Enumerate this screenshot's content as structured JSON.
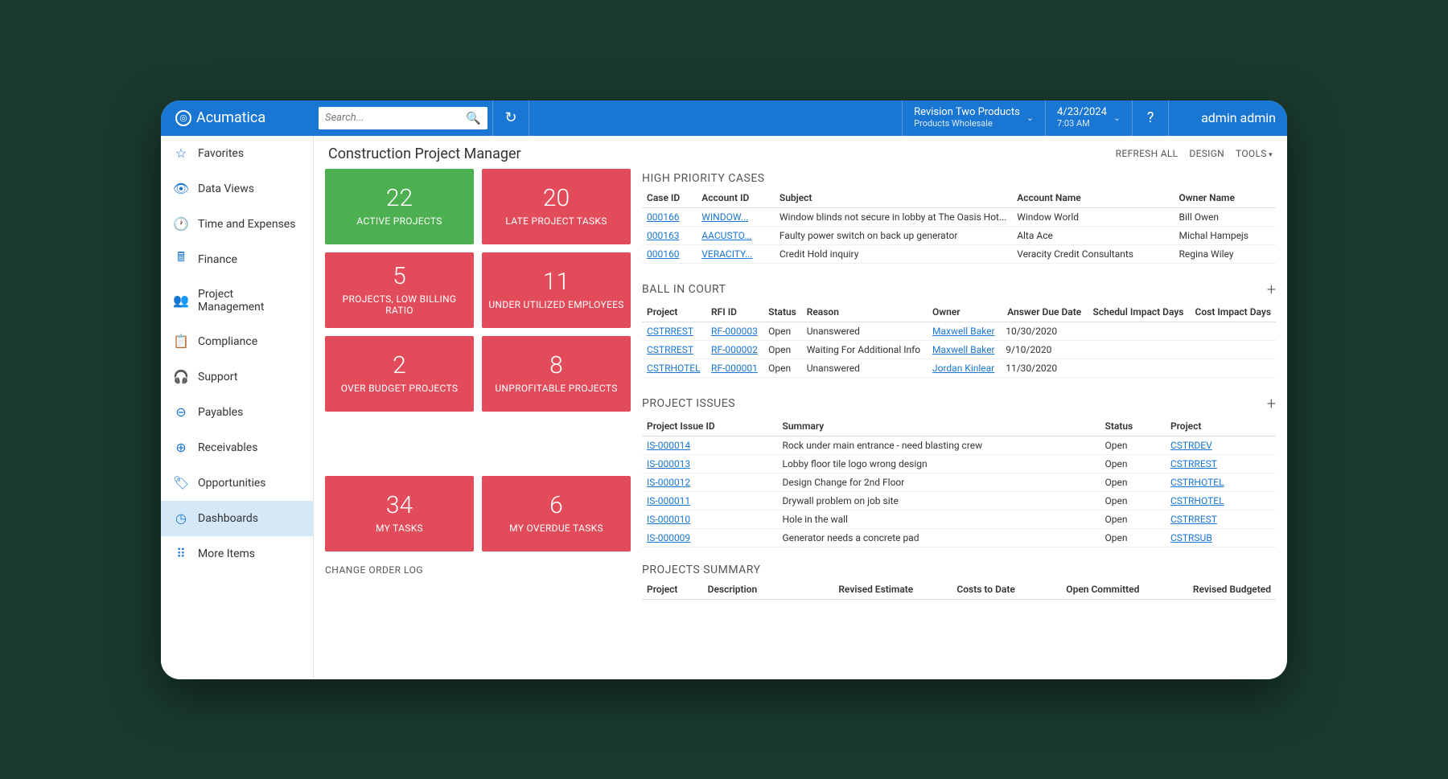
{
  "brand": "Acumatica",
  "search": {
    "placeholder": "Search..."
  },
  "topbar": {
    "company": {
      "name": "Revision Two Products",
      "sub": "Products Wholesale"
    },
    "date": {
      "date": "4/23/2024",
      "time": "7:03 AM"
    },
    "user": "admin admin"
  },
  "sidebar": [
    {
      "icon": "star",
      "label": "Favorites"
    },
    {
      "icon": "eye",
      "label": "Data Views"
    },
    {
      "icon": "clock",
      "label": "Time and Expenses"
    },
    {
      "icon": "calc",
      "label": "Finance"
    },
    {
      "icon": "people",
      "label": "Project Management"
    },
    {
      "icon": "doc",
      "label": "Compliance"
    },
    {
      "icon": "headset",
      "label": "Support"
    },
    {
      "icon": "minus",
      "label": "Payables"
    },
    {
      "icon": "plus",
      "label": "Receivables"
    },
    {
      "icon": "tag",
      "label": "Opportunities"
    },
    {
      "icon": "gauge",
      "label": "Dashboards",
      "active": true
    },
    {
      "icon": "grid",
      "label": "More Items"
    }
  ],
  "page": {
    "title": "Construction Project Manager",
    "actions": {
      "refresh": "REFRESH ALL",
      "design": "DESIGN",
      "tools": "TOOLS"
    }
  },
  "tiles": [
    [
      {
        "num": "22",
        "label": "ACTIVE PROJECTS",
        "color": "green"
      },
      {
        "num": "20",
        "label": "LATE PROJECT TASKS",
        "color": "red"
      }
    ],
    [
      {
        "num": "5",
        "label": "PROJECTS, LOW BILLING RATIO",
        "color": "red"
      },
      {
        "num": "11",
        "label": "UNDER UTILIZED EMPLOYEES",
        "color": "red"
      }
    ],
    [
      {
        "num": "2",
        "label": "OVER BUDGET PROJECTS",
        "color": "red"
      },
      {
        "num": "8",
        "label": "UNPROFITABLE PROJECTS",
        "color": "red"
      }
    ],
    [
      {
        "num": "34",
        "label": "MY TASKS",
        "color": "red"
      },
      {
        "num": "6",
        "label": "MY OVERDUE TASKS",
        "color": "red"
      }
    ]
  ],
  "change_order_title": "CHANGE ORDER LOG",
  "sections": {
    "high_priority": {
      "title": "HIGH PRIORITY CASES",
      "headers": [
        "Case ID",
        "Account ID",
        "Subject",
        "Account Name",
        "Owner Name"
      ],
      "rows": [
        {
          "case": "000166",
          "acct": "WINDOW...",
          "subj": "Window blinds not secure in lobby at The Oasis Hot...",
          "acctname": "Window World",
          "owner": "Bill Owen"
        },
        {
          "case": "000163",
          "acct": "AACUSTO...",
          "subj": "Faulty power switch on back up generator",
          "acctname": "Alta Ace",
          "owner": "Michal Hampejs"
        },
        {
          "case": "000160",
          "acct": "VERACITY...",
          "subj": "Credit Hold inquiry",
          "acctname": "Veracity Credit Consultants",
          "owner": "Regina Wiley"
        }
      ]
    },
    "ball_in_court": {
      "title": "BALL IN COURT",
      "headers": [
        "Project",
        "RFI ID",
        "Status",
        "Reason",
        "Owner",
        "Answer Due Date",
        "Schedul Impact Days",
        "Cost Impact Days"
      ],
      "rows": [
        {
          "proj": "CSTRREST",
          "rfi": "RF-000003",
          "status": "Open",
          "reason": "Unanswered",
          "owner": "Maxwell Baker",
          "due": "10/30/2020"
        },
        {
          "proj": "CSTRREST",
          "rfi": "RF-000002",
          "status": "Open",
          "reason": "Waiting For Additional Info",
          "owner": "Maxwell Baker",
          "due": "9/10/2020"
        },
        {
          "proj": "CSTRHOTEL",
          "rfi": "RF-000001",
          "status": "Open",
          "reason": "Unanswered",
          "owner": "Jordan Kinlear",
          "due": "11/30/2020"
        }
      ]
    },
    "project_issues": {
      "title": "PROJECT ISSUES",
      "headers": [
        "Project Issue ID",
        "Summary",
        "Status",
        "Project"
      ],
      "rows": [
        {
          "id": "IS-000014",
          "summary": "Rock under main entrance - need blasting crew",
          "status": "Open",
          "proj": "CSTRDEV"
        },
        {
          "id": "IS-000013",
          "summary": "Lobby floor tile logo wrong design",
          "status": "Open",
          "proj": "CSTRREST"
        },
        {
          "id": "IS-000012",
          "summary": "Design Change for 2nd Floor",
          "status": "Open",
          "proj": "CSTRHOTEL"
        },
        {
          "id": "IS-000011",
          "summary": "Drywall problem on job site",
          "status": "Open",
          "proj": "CSTRHOTEL"
        },
        {
          "id": "IS-000010",
          "summary": "Hole in the wall",
          "status": "Open",
          "proj": "CSTRREST"
        },
        {
          "id": "IS-000009",
          "summary": "Generator needs a concrete pad",
          "status": "Open",
          "proj": "CSTRSUB"
        }
      ]
    },
    "projects_summary": {
      "title": "PROJECTS SUMMARY",
      "headers": [
        "Project",
        "Description",
        "Revised Estimate",
        "Costs to Date",
        "Open Committed",
        "Revised Budgeted"
      ]
    }
  }
}
